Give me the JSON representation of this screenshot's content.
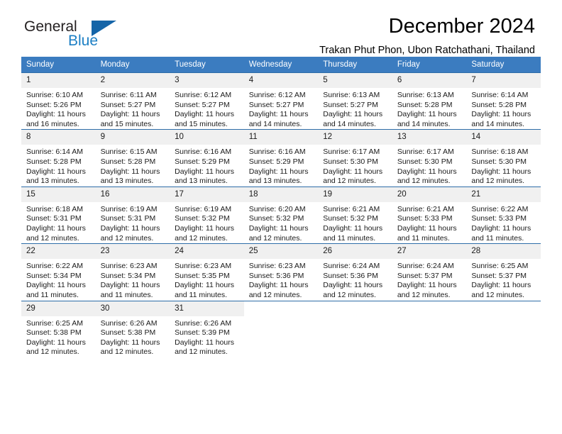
{
  "brand": {
    "name_part1": "General",
    "name_part2": "Blue",
    "triangle_icon": "triangle-logo-icon",
    "accent_color": "#1c7fc4"
  },
  "header": {
    "title": "December 2024",
    "subtitle": "Trakan Phut Phon, Ubon Ratchathani, Thailand"
  },
  "theme": {
    "header_bg": "#3b7cc0",
    "row_border": "#2e6da8",
    "daynum_bg": "#f0f0f0"
  },
  "weekdays": [
    "Sunday",
    "Monday",
    "Tuesday",
    "Wednesday",
    "Thursday",
    "Friday",
    "Saturday"
  ],
  "weeks": [
    [
      {
        "day": "1",
        "sunrise": "Sunrise: 6:10 AM",
        "sunset": "Sunset: 5:26 PM",
        "daylight": "Daylight: 11 hours and 16 minutes."
      },
      {
        "day": "2",
        "sunrise": "Sunrise: 6:11 AM",
        "sunset": "Sunset: 5:27 PM",
        "daylight": "Daylight: 11 hours and 15 minutes."
      },
      {
        "day": "3",
        "sunrise": "Sunrise: 6:12 AM",
        "sunset": "Sunset: 5:27 PM",
        "daylight": "Daylight: 11 hours and 15 minutes."
      },
      {
        "day": "4",
        "sunrise": "Sunrise: 6:12 AM",
        "sunset": "Sunset: 5:27 PM",
        "daylight": "Daylight: 11 hours and 14 minutes."
      },
      {
        "day": "5",
        "sunrise": "Sunrise: 6:13 AM",
        "sunset": "Sunset: 5:27 PM",
        "daylight": "Daylight: 11 hours and 14 minutes."
      },
      {
        "day": "6",
        "sunrise": "Sunrise: 6:13 AM",
        "sunset": "Sunset: 5:28 PM",
        "daylight": "Daylight: 11 hours and 14 minutes."
      },
      {
        "day": "7",
        "sunrise": "Sunrise: 6:14 AM",
        "sunset": "Sunset: 5:28 PM",
        "daylight": "Daylight: 11 hours and 14 minutes."
      }
    ],
    [
      {
        "day": "8",
        "sunrise": "Sunrise: 6:14 AM",
        "sunset": "Sunset: 5:28 PM",
        "daylight": "Daylight: 11 hours and 13 minutes."
      },
      {
        "day": "9",
        "sunrise": "Sunrise: 6:15 AM",
        "sunset": "Sunset: 5:28 PM",
        "daylight": "Daylight: 11 hours and 13 minutes."
      },
      {
        "day": "10",
        "sunrise": "Sunrise: 6:16 AM",
        "sunset": "Sunset: 5:29 PM",
        "daylight": "Daylight: 11 hours and 13 minutes."
      },
      {
        "day": "11",
        "sunrise": "Sunrise: 6:16 AM",
        "sunset": "Sunset: 5:29 PM",
        "daylight": "Daylight: 11 hours and 13 minutes."
      },
      {
        "day": "12",
        "sunrise": "Sunrise: 6:17 AM",
        "sunset": "Sunset: 5:30 PM",
        "daylight": "Daylight: 11 hours and 12 minutes."
      },
      {
        "day": "13",
        "sunrise": "Sunrise: 6:17 AM",
        "sunset": "Sunset: 5:30 PM",
        "daylight": "Daylight: 11 hours and 12 minutes."
      },
      {
        "day": "14",
        "sunrise": "Sunrise: 6:18 AM",
        "sunset": "Sunset: 5:30 PM",
        "daylight": "Daylight: 11 hours and 12 minutes."
      }
    ],
    [
      {
        "day": "15",
        "sunrise": "Sunrise: 6:18 AM",
        "sunset": "Sunset: 5:31 PM",
        "daylight": "Daylight: 11 hours and 12 minutes."
      },
      {
        "day": "16",
        "sunrise": "Sunrise: 6:19 AM",
        "sunset": "Sunset: 5:31 PM",
        "daylight": "Daylight: 11 hours and 12 minutes."
      },
      {
        "day": "17",
        "sunrise": "Sunrise: 6:19 AM",
        "sunset": "Sunset: 5:32 PM",
        "daylight": "Daylight: 11 hours and 12 minutes."
      },
      {
        "day": "18",
        "sunrise": "Sunrise: 6:20 AM",
        "sunset": "Sunset: 5:32 PM",
        "daylight": "Daylight: 11 hours and 12 minutes."
      },
      {
        "day": "19",
        "sunrise": "Sunrise: 6:21 AM",
        "sunset": "Sunset: 5:32 PM",
        "daylight": "Daylight: 11 hours and 11 minutes."
      },
      {
        "day": "20",
        "sunrise": "Sunrise: 6:21 AM",
        "sunset": "Sunset: 5:33 PM",
        "daylight": "Daylight: 11 hours and 11 minutes."
      },
      {
        "day": "21",
        "sunrise": "Sunrise: 6:22 AM",
        "sunset": "Sunset: 5:33 PM",
        "daylight": "Daylight: 11 hours and 11 minutes."
      }
    ],
    [
      {
        "day": "22",
        "sunrise": "Sunrise: 6:22 AM",
        "sunset": "Sunset: 5:34 PM",
        "daylight": "Daylight: 11 hours and 11 minutes."
      },
      {
        "day": "23",
        "sunrise": "Sunrise: 6:23 AM",
        "sunset": "Sunset: 5:34 PM",
        "daylight": "Daylight: 11 hours and 11 minutes."
      },
      {
        "day": "24",
        "sunrise": "Sunrise: 6:23 AM",
        "sunset": "Sunset: 5:35 PM",
        "daylight": "Daylight: 11 hours and 11 minutes."
      },
      {
        "day": "25",
        "sunrise": "Sunrise: 6:23 AM",
        "sunset": "Sunset: 5:36 PM",
        "daylight": "Daylight: 11 hours and 12 minutes."
      },
      {
        "day": "26",
        "sunrise": "Sunrise: 6:24 AM",
        "sunset": "Sunset: 5:36 PM",
        "daylight": "Daylight: 11 hours and 12 minutes."
      },
      {
        "day": "27",
        "sunrise": "Sunrise: 6:24 AM",
        "sunset": "Sunset: 5:37 PM",
        "daylight": "Daylight: 11 hours and 12 minutes."
      },
      {
        "day": "28",
        "sunrise": "Sunrise: 6:25 AM",
        "sunset": "Sunset: 5:37 PM",
        "daylight": "Daylight: 11 hours and 12 minutes."
      }
    ],
    [
      {
        "day": "29",
        "sunrise": "Sunrise: 6:25 AM",
        "sunset": "Sunset: 5:38 PM",
        "daylight": "Daylight: 11 hours and 12 minutes."
      },
      {
        "day": "30",
        "sunrise": "Sunrise: 6:26 AM",
        "sunset": "Sunset: 5:38 PM",
        "daylight": "Daylight: 11 hours and 12 minutes."
      },
      {
        "day": "31",
        "sunrise": "Sunrise: 6:26 AM",
        "sunset": "Sunset: 5:39 PM",
        "daylight": "Daylight: 11 hours and 12 minutes."
      },
      {
        "day": "",
        "sunrise": "",
        "sunset": "",
        "daylight": ""
      },
      {
        "day": "",
        "sunrise": "",
        "sunset": "",
        "daylight": ""
      },
      {
        "day": "",
        "sunrise": "",
        "sunset": "",
        "daylight": ""
      },
      {
        "day": "",
        "sunrise": "",
        "sunset": "",
        "daylight": ""
      }
    ]
  ]
}
